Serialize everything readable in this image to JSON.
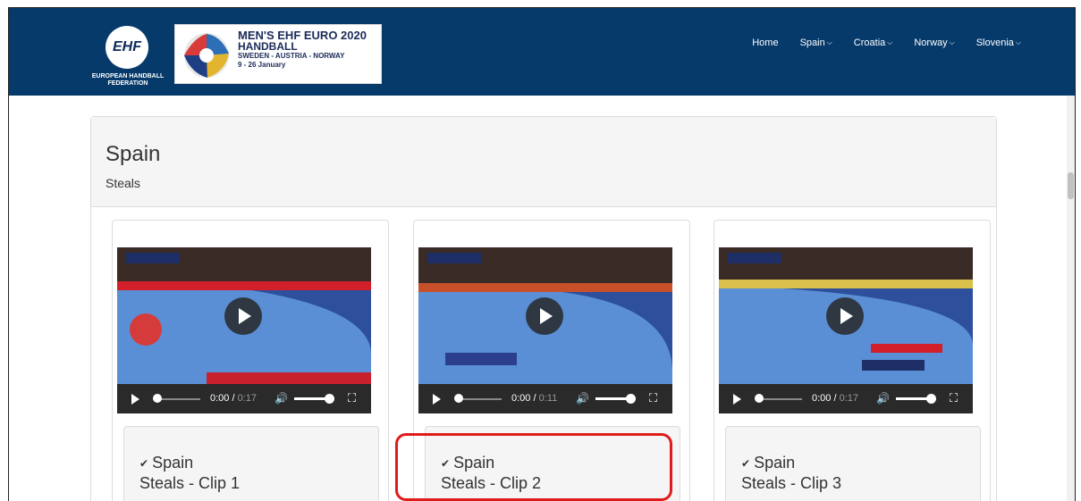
{
  "header": {
    "ehf_logo_text": "EHF",
    "ehf_caption": "EUROPEAN HANDBALL FEDERATION",
    "euro_banner": {
      "line1": "MEN'S EHF EURO 2020",
      "line2": "HANDBALL",
      "line3": "SWEDEN - AUSTRIA - NORWAY",
      "line4": "9 - 26 January"
    },
    "nav": [
      {
        "label": "Home",
        "dropdown": false
      },
      {
        "label": "Spain",
        "dropdown": true
      },
      {
        "label": "Croatia",
        "dropdown": true
      },
      {
        "label": "Norway",
        "dropdown": true
      },
      {
        "label": "Slovenia",
        "dropdown": true
      }
    ]
  },
  "panel": {
    "title": "Spain",
    "subtitle": "Steals"
  },
  "cards": [
    {
      "time": "0:00",
      "duration": "0:17",
      "group": "Spain",
      "clip": "Steals - Clip 1"
    },
    {
      "time": "0:00",
      "duration": "0:11",
      "group": "Spain",
      "clip": "Steals - Clip 2"
    },
    {
      "time": "0:00",
      "duration": "0:17",
      "group": "Spain",
      "clip": "Steals - Clip 3"
    }
  ],
  "icons": {
    "nav_chevron": "chevron-down-icon",
    "caption_caret": "caret-down-icon",
    "volume": "volume-icon",
    "fullscreen": "fullscreen-icon"
  },
  "colors": {
    "header_bg": "#063a6b",
    "highlight": "#e01b1b"
  }
}
